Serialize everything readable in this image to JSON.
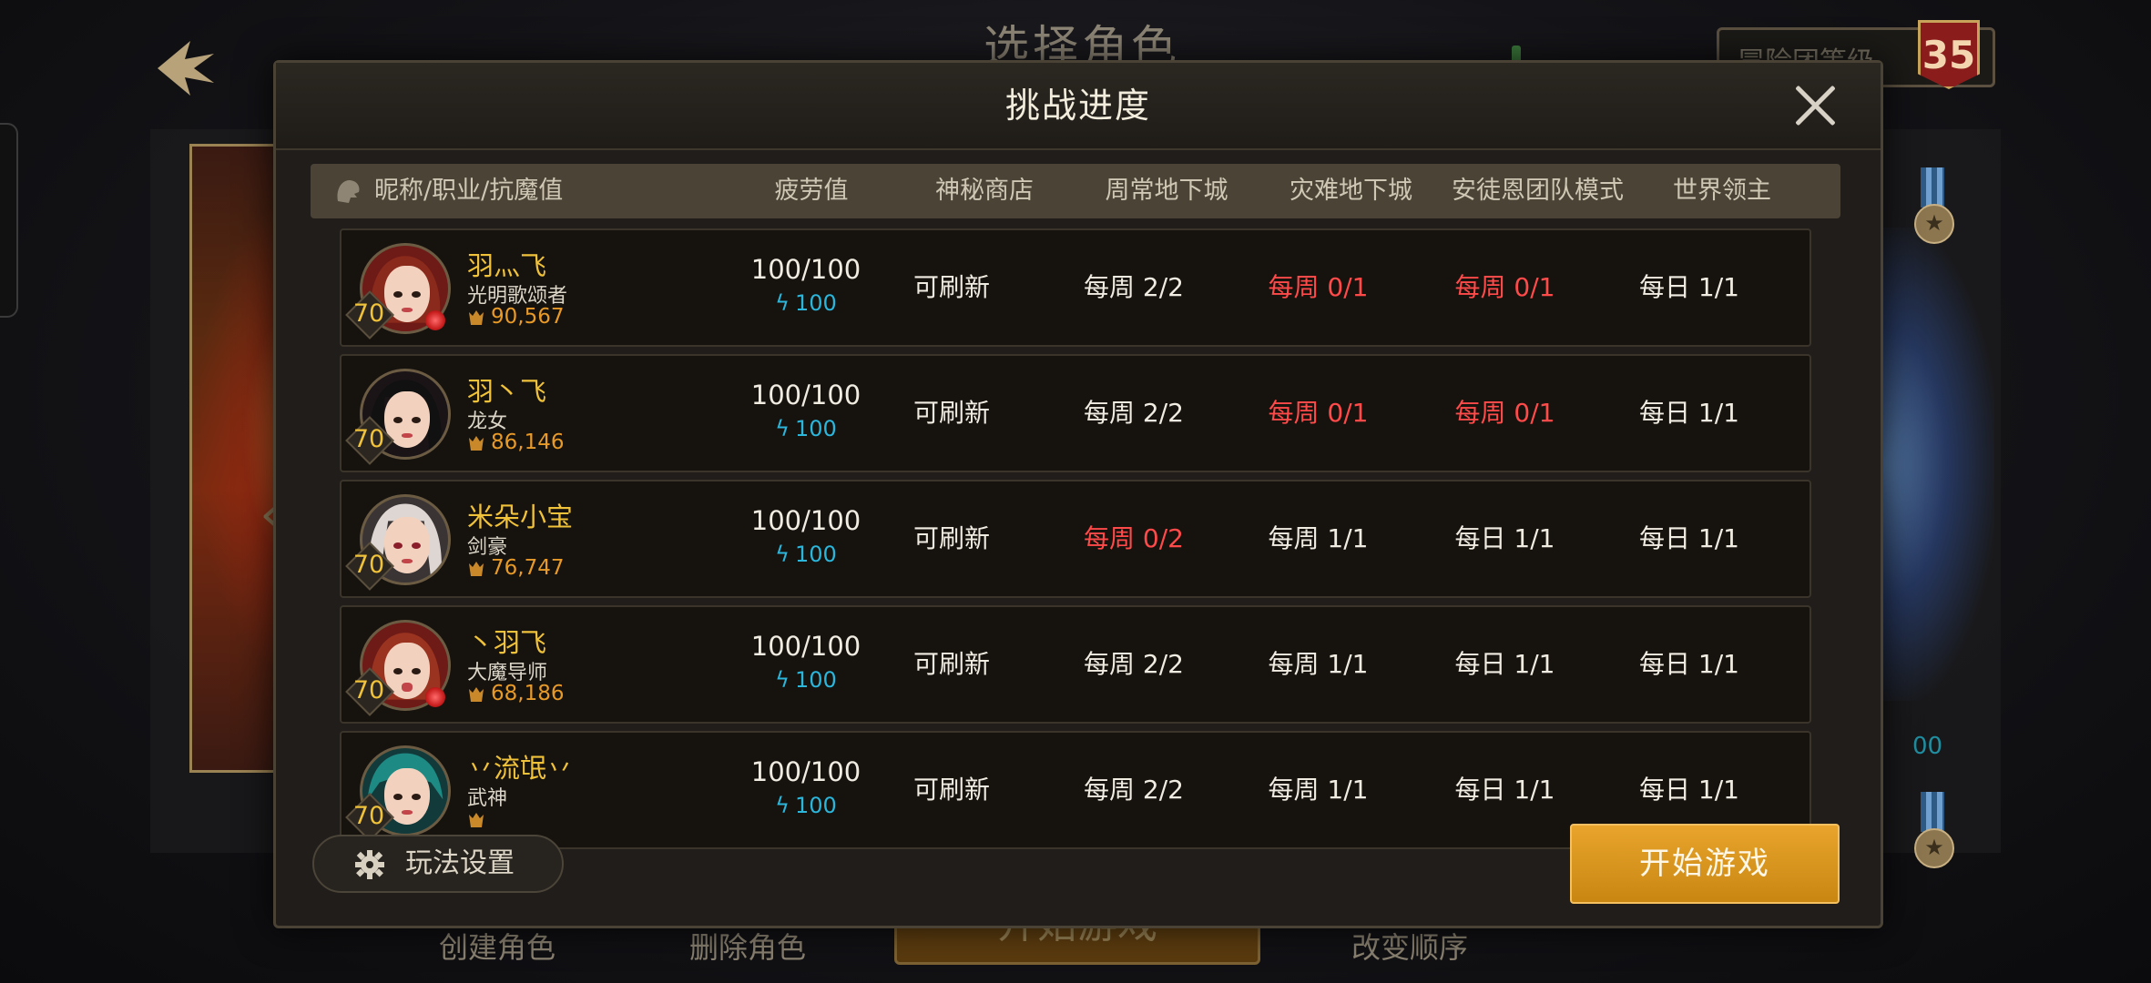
{
  "background": {
    "title": "选择角色",
    "adventure_level_label": "冒险团等级",
    "adventure_level": "35",
    "bottom": {
      "create": "创建角色",
      "delete": "删除角色",
      "start": "开始游戏",
      "reorder": "改变顺序"
    },
    "right_number": "00"
  },
  "modal": {
    "title": "挑战进度",
    "columns": {
      "name": "昵称/职业/抗魔值",
      "fatigue": "疲劳值",
      "shop": "神秘商店",
      "weekly": "周常地下城",
      "disaster": "灾难地下城",
      "antoine": "安徒恩团队模式",
      "boss": "世界领主"
    },
    "rows": [
      {
        "name": "羽灬飞",
        "job": "光明歌颂者",
        "level": "70",
        "power": "90,567",
        "fatigue": "100/100",
        "fatigue_sub": "100",
        "shop": "可刷新",
        "weekly": "每周 2/2",
        "disaster": "每周 0/1",
        "antoine": "每周 0/1",
        "boss": "每日 1/1"
      },
      {
        "name": "羽丶飞",
        "job": "龙女",
        "level": "70",
        "power": "86,146",
        "fatigue": "100/100",
        "fatigue_sub": "100",
        "shop": "可刷新",
        "weekly": "每周 2/2",
        "disaster": "每周 0/1",
        "antoine": "每周 0/1",
        "boss": "每日 1/1"
      },
      {
        "name": "米朵小宝",
        "job": "剑豪",
        "level": "70",
        "power": "76,747",
        "fatigue": "100/100",
        "fatigue_sub": "100",
        "shop": "可刷新",
        "weekly": "每周 0/2",
        "disaster": "每周 1/1",
        "antoine": "每日 1/1",
        "boss": "每日 1/1"
      },
      {
        "name": "丶羽飞",
        "job": "大魔导师",
        "level": "70",
        "power": "68,186",
        "fatigue": "100/100",
        "fatigue_sub": "100",
        "shop": "可刷新",
        "weekly": "每周 2/2",
        "disaster": "每周 1/1",
        "antoine": "每日 1/1",
        "boss": "每日 1/1"
      },
      {
        "name": "丷流氓丷",
        "job": "武神",
        "level": "70",
        "power": "",
        "fatigue": "100/100",
        "fatigue_sub": "100",
        "shop": "可刷新",
        "weekly": "每周 2/2",
        "disaster": "每周 1/1",
        "antoine": "每日 1/1",
        "boss": "每日 1/1"
      }
    ],
    "gameplay_settings": "玩法设置",
    "start_game": "开始游戏"
  },
  "colors": {
    "accent_gold": "#f0c23a",
    "power_orange": "#e89a28",
    "fatigue_cyan": "#2bb6dc",
    "alert_red": "#ff4a4a",
    "start_button": "#e8a42c"
  },
  "icons": {
    "back": "back-arrow-icon",
    "close": "close-icon",
    "header": "character-head-icon",
    "power": "demon-resist-icon",
    "fatigue": "lightning-icon",
    "settings": "gear-icon"
  }
}
